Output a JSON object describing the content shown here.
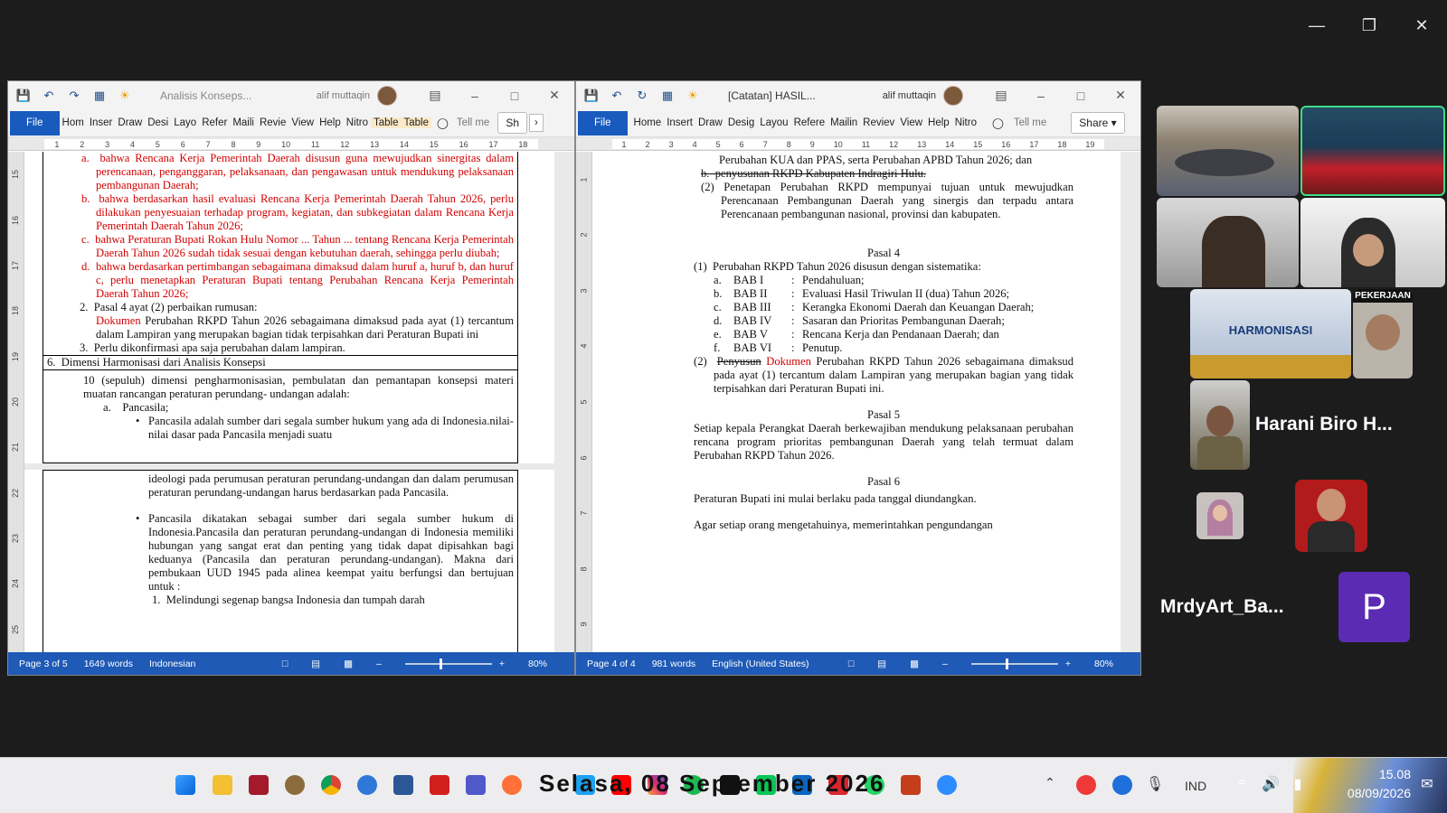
{
  "window_controls": {
    "min": "—",
    "restore": "❐",
    "close": "✕"
  },
  "left_doc": {
    "title": "Analisis Konseps...",
    "user": "alif muttaqin",
    "tabs": [
      "File",
      "Hom",
      "Inser",
      "Draw",
      "Desi",
      "Layo",
      "Refer",
      "Maili",
      "Revie",
      "View",
      "Help",
      "Nitro",
      "Table",
      "Table"
    ],
    "tell_me": "Tell me",
    "share": "Sh",
    "ruler": [
      "1",
      "2",
      "3",
      "4",
      "5",
      "6",
      "7",
      "8",
      "9",
      "10",
      "11",
      "12",
      "13",
      "14",
      "15",
      "16",
      "17",
      "18"
    ],
    "vruler": [
      "15",
      "16",
      "17",
      "18",
      "19",
      "20",
      "21",
      "22",
      "23",
      "24",
      "25"
    ],
    "para_a": "a.  bahwa Rencana Kerja Pemerintah Daerah disusun guna mewujudkan sinergitas dalam perencanaan, penganggaran, pelaksanaan, dan pengawasan untuk mendukung pelaksanaan pembangunan Daerah;",
    "para_b": "b.  bahwa berdasarkan hasil evaluasi Rencana Kerja Pemerintah Daerah Tahun 2026, perlu dilakukan penyesuaian terhadap program, kegiatan, dan subkegiatan dalam Rencana Kerja Pemerintah Daerah Tahun 2026;",
    "para_c": "c.  bahwa Peraturan Bupati Rokan Hulu Nomor ... Tahun ... tentang Rencana Kerja Pemerintah Daerah Tahun 2026 sudah tidak sesuai dengan kebutuhan daerah, sehingga perlu diubah;",
    "para_d": "d.  bahwa berdasarkan pertimbangan sebagaimana dimaksud dalam huruf a, huruf b, dan huruf c, perlu menetapkan Peraturan Bupati tentang Perubahan Rencana Kerja Pemerintah Daerah Tahun 2026;",
    "item2": "2.  Pasal 4 ayat (2) perbaikan rumusan:",
    "dok_red": "Dokumen",
    "dok_rest": " Perubahan RKPD Tahun 2026 sebagaimana dimaksud pada ayat (1) tercantum dalam Lampiran yang merupakan bagian tidak terpisahkan dari Peraturan Bupati ini",
    "item3": "3.  Perlu dikonfirmasi apa saja perubahan dalam lampiran.",
    "row6": "6.  Dimensi Harmonisasi dari Analisis Konsepsi",
    "dim_intro": "10 (sepuluh) dimensi pengharmonisasian, pembulatan dan pemantapan konsepsi materi muatan rancangan peraturan perundang- undangan adalah:",
    "pancasila": "a.    Pancasila;",
    "bullet1": "Pancasila adalah sumber dari segala sumber hukum yang ada di Indonesia.nilai-nilai dasar pada Pancasila menjadi suatu",
    "page2_p1": "ideologi pada perumusan peraturan perundang-undangan dan dalam perumusan peraturan perundang-undangan harus berdasarkan pada Pancasila.",
    "bullet2": "Pancasila dikatakan sebagai sumber dari segala sumber hukum di Indonesia.Pancasila dan peraturan perundang-undangan di Indonesia memiliki hubungan yang sangat erat dan penting yang tidak dapat dipisahkan bagi keduanya (Pancasila dan peraturan perundang-undangan). Makna dari pembukaan UUD 1945 pada alinea keempat yaitu berfungsi dan bertujuan untuk :",
    "num1": "1.  Melindungi segenap bangsa Indonesia dan tumpah darah",
    "status_page": "Page 3 of 5",
    "status_words": "1649 words",
    "status_lang": "Indonesian",
    "zoom": "80%"
  },
  "right_doc": {
    "title": "[Catatan] HASIL...",
    "user": "alif muttaqin",
    "tabs": [
      "File",
      "Home",
      "Insert",
      "Draw",
      "Desig",
      "Layou",
      "Refere",
      "Mailin",
      "Reviev",
      "View",
      "Help",
      "Nitro"
    ],
    "tell_me": "Tell me",
    "share": "Share",
    "ruler": [
      "1",
      "2",
      "3",
      "4",
      "5",
      "6",
      "7",
      "8",
      "9",
      "10",
      "11",
      "12",
      "13",
      "14",
      "15",
      "16",
      "17",
      "18",
      "19"
    ],
    "vruler": [
      "1",
      "2",
      "3",
      "4",
      "5",
      "6",
      "7",
      "8",
      "9"
    ],
    "l1": "Perubahan KUA dan PPAS, serta Perubahan APBD Tahun 2026; dan",
    "l2": "b.  penyusunan RKPD Kabupaten Indragiri Hulu.",
    "l3": "(2) Penetapan Perubahan RKPD mempunyai tujuan untuk mewujudkan Perencanaan Pembangunan Daerah yang sinergis dan terpadu antara Perencanaan pembangunan nasional, provinsi dan kabupaten.",
    "pasal4": "Pasal 4",
    "p4_1": "(1)  Perubahan RKPD Tahun 2026 disusun dengan sistematika:",
    "bab": [
      [
        "a.",
        "BAB I",
        ":",
        "Pendahuluan;"
      ],
      [
        "b.",
        "BAB II",
        ":",
        "Evaluasi Hasil Triwulan II (dua) Tahun 2026;"
      ],
      [
        "c.",
        "BAB III",
        ":",
        "Kerangka Ekonomi Daerah dan Keuangan Daerah;"
      ],
      [
        "d.",
        "BAB IV",
        ":",
        "Sasaran dan Prioritas Pembangunan Daerah;"
      ],
      [
        "e.",
        "BAB V",
        ":",
        "Rencana Kerja dan Pendanaan Daerah; dan"
      ],
      [
        "f.",
        "BAB VI",
        ":",
        "Penutup."
      ]
    ],
    "p4_2_num": "(2)",
    "p4_2_strike": "Penyusun",
    "p4_2_red": "Dokumen",
    "p4_2_rest": " Perubahan RKPD Tahun 2026 sebagaimana dimaksud pada ayat (1) tercantum dalam Lampiran yang merupakan bagian yang tidak terpisahkan dari Peraturan Bupati ini.",
    "pasal5": "Pasal 5",
    "p5": "Setiap kepala Perangkat Daerah berkewajiban mendukung pelaksanaan perubahan rencana program prioritas pembangunan Daerah yang telah termuat dalam Perubahan RKPD Tahun 2026.",
    "pasal6": "Pasal 6",
    "p6": "Peraturan Bupati ini mulai berlaku pada tanggal diundangkan.",
    "p7": "Agar setiap orang mengetahuinya, memerintahkan pengundangan",
    "status_page": "Page 4 of 4",
    "status_words": "981 words",
    "status_lang": "English (United States)",
    "zoom": "80%"
  },
  "meeting": {
    "tile_harmonisasi": "HARMONISASI",
    "tile_pekerjaan": "PEKERJAAN",
    "participant1": "Harani Biro H...",
    "participant2": "MrdyArt_Ba...",
    "avatar_letter": "P",
    "avatar_color": "#5b2bb3"
  },
  "taskbar": {
    "marquee": "Selasa, 08 September 2026",
    "lang": "IND",
    "time": "15.08",
    "date": "08/09/2026"
  }
}
